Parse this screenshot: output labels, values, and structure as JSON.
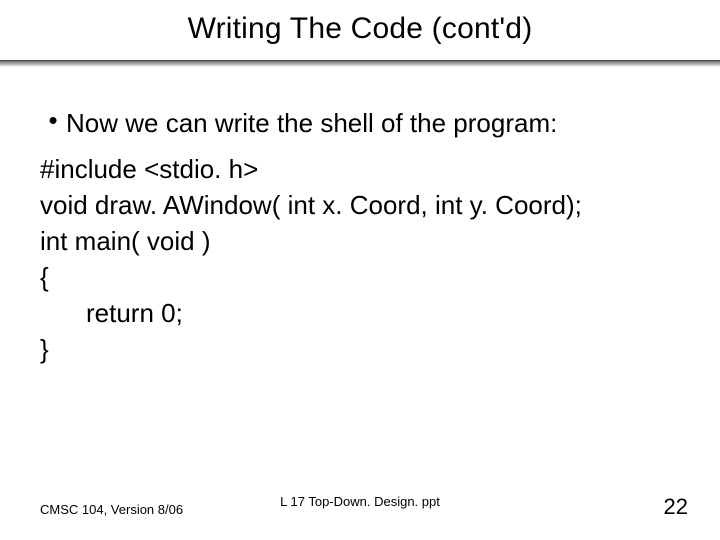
{
  "title": "Writing The Code (cont'd)",
  "bullet": {
    "glyph": "•",
    "text": "Now we can write the shell of the program:"
  },
  "code": {
    "l1": "#include <stdio. h>",
    "l2": "void draw. AWindow( int x. Coord, int y. Coord);",
    "l3": "int main( void )",
    "l4": "{",
    "l5": "return 0;",
    "l6": "}"
  },
  "footer": {
    "left": "CMSC 104, Version 8/06",
    "center": "L 17 Top-Down. Design. ppt",
    "right": "22"
  }
}
